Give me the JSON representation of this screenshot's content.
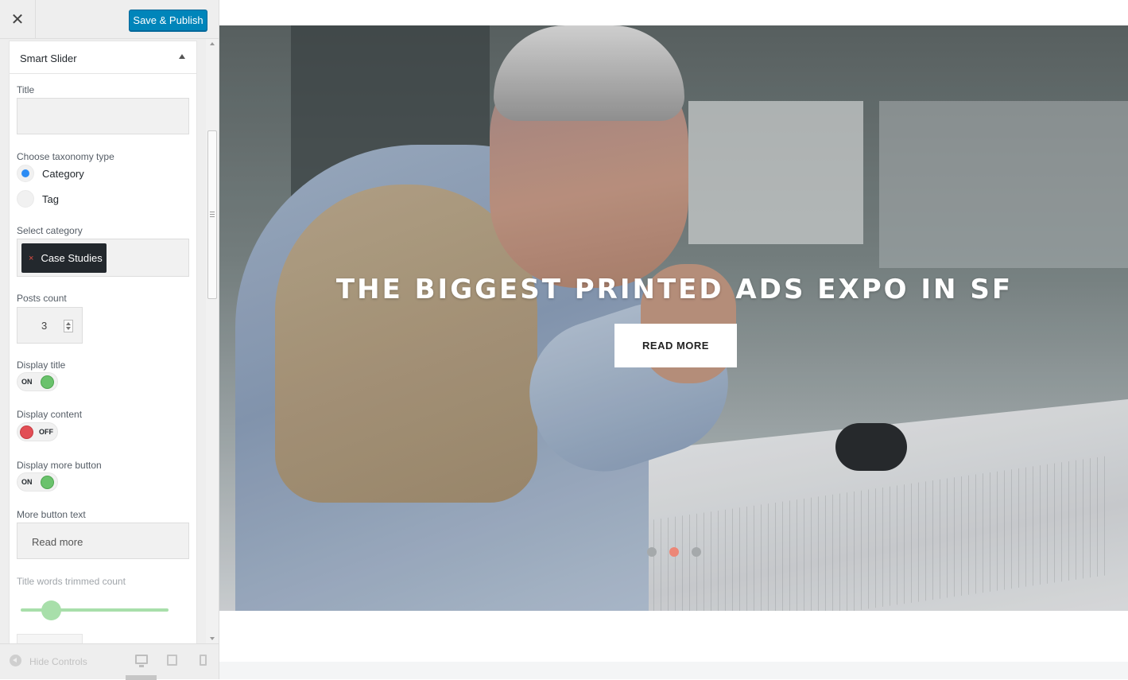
{
  "topbar": {
    "close_icon": "close-icon",
    "close_symbol": "✕",
    "publish_label": "Save & Publish",
    "accent_color": "#0085ba"
  },
  "panel": {
    "title": "Smart Slider",
    "fields": {
      "title_label": "Title",
      "title_value": "",
      "taxonomy_label": "Choose taxonomy type",
      "taxonomy_options": [
        {
          "label": "Category",
          "checked": true
        },
        {
          "label": "Tag",
          "checked": false
        }
      ],
      "select_category_label": "Select category",
      "selected_category": "Case Studies",
      "remove_symbol": "×",
      "posts_count_label": "Posts count",
      "posts_count_value": "3",
      "display_title_label": "Display title",
      "display_title_state": "ON",
      "display_content_label": "Display content",
      "display_content_state": "OFF",
      "display_more_label": "Display more button",
      "display_more_state": "ON",
      "more_button_text_label": "More button text",
      "more_button_text_value": "Read more",
      "title_trim_label": "Title words trimmed count"
    }
  },
  "footer": {
    "hide_label": "Hide Controls",
    "devices": [
      "desktop",
      "tablet",
      "mobile"
    ],
    "active_device": "desktop"
  },
  "preview": {
    "slide_title": "THE BIGGEST PRINTED ADS EXPO IN SF",
    "slide_button": "READ MORE",
    "dots": 3,
    "active_dot": 2,
    "active_dot_color": "#ec8777"
  }
}
